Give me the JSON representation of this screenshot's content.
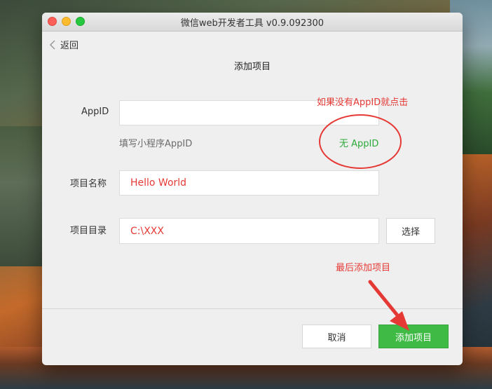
{
  "window": {
    "title": "微信web开发者工具 v0.9.092300"
  },
  "nav": {
    "back_label": "返回"
  },
  "page": {
    "title": "添加项目"
  },
  "form": {
    "appid_label": "AppID",
    "appid_value": "",
    "appid_hint": "填写小程序AppID",
    "no_appid_label": "无 AppID",
    "project_name_label": "项目名称",
    "project_name_value": "Hello World",
    "project_dir_label": "项目目录",
    "project_dir_value": "C:\\XXX",
    "choose_label": "选择"
  },
  "footer": {
    "cancel_label": "取消",
    "add_label": "添加项目"
  },
  "annotations": {
    "no_appid_tip": "如果没有AppID就点击",
    "final_tip": "最后添加项目"
  },
  "colors": {
    "annotation": "#e53935",
    "accent_green": "#3fbb45"
  }
}
